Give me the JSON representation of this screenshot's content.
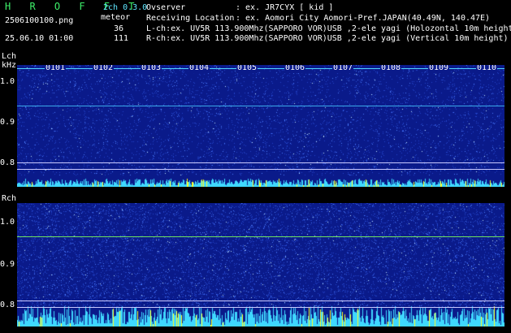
{
  "header": {
    "app_title": "H R O F F T",
    "mode": "2ch 0.3.0",
    "meteor_label": "meteor",
    "filename": "2506100100.png",
    "count_l": "36",
    "datetime": "25.06.10 01:00",
    "count_r": "111",
    "observer_label": "Ovserver",
    "observer_value": ": ex. JR7CYX [ kid ]",
    "location_label": "Receiving Location",
    "location_value": ": ex. Aomori City Aomori-Pref.JAPAN(40.49N, 140.47E)",
    "lch_line": "L-ch:ex. UV5R 113.900Mhz(SAPPORO VOR)USB ,2-ele yagi (Holozontal 10m height",
    "rch_line": "R-ch:ex. UV5R 113.900Mhz(SAPPORO VOR)USB ,2-ele yagi (Vertical 10m height)"
  },
  "left_panel": {
    "channel_label": "Lch",
    "unit_label": "kHz",
    "y_ticks": [
      "1.0",
      "0.9",
      "0.8"
    ],
    "time_markers": [
      "0101",
      "0102",
      "0103",
      "0104",
      "0105",
      "0106",
      "0107",
      "0108",
      "0109",
      "0110"
    ]
  },
  "right_panel": {
    "channel_label": "Rch",
    "y_ticks": [
      "1.0",
      "0.9",
      "0.8"
    ]
  },
  "colors": {
    "background": "#000000",
    "spectrogram": "#0a1a8a",
    "text_green": "#3ef06a",
    "text_cyan": "#5fe7ff",
    "signal_line": "#4fd6ff",
    "histogram": "#3fd8ff",
    "histogram_peak": "#ffff20"
  }
}
